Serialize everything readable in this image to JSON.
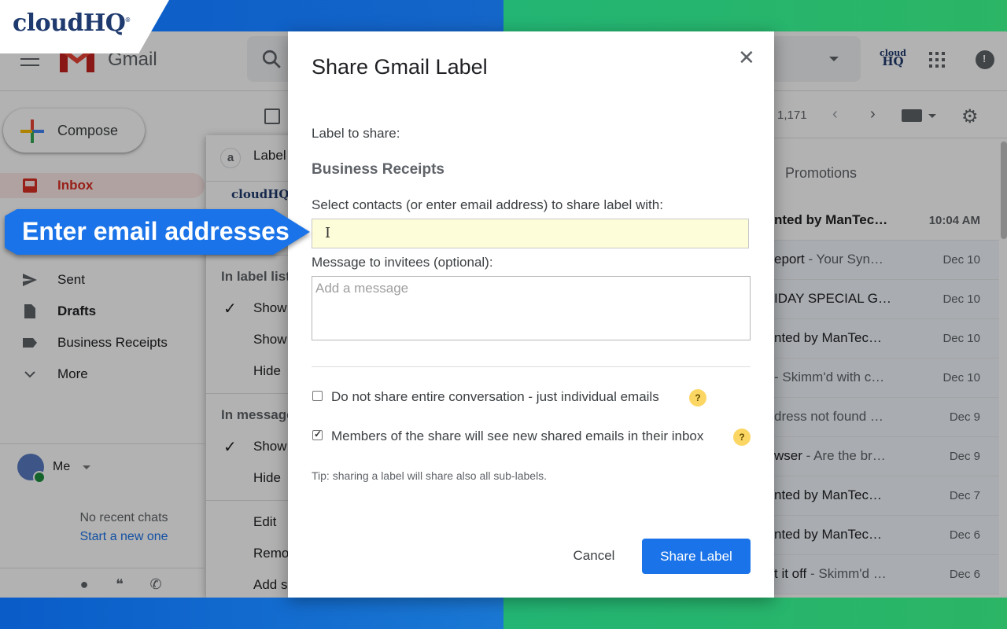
{
  "brand": {
    "name": "cloudHQ",
    "mark": "®"
  },
  "gmail": {
    "product": "Gmail",
    "compose_label": "Compose",
    "nav": [
      {
        "label": "Inbox",
        "icon": "inbox-icon"
      },
      {
        "label": "Sent",
        "icon": "send-icon"
      },
      {
        "label": "Drafts",
        "icon": "draft-icon"
      },
      {
        "label": "Business Receipts",
        "icon": "label-icon"
      },
      {
        "label": "More",
        "icon": "chevron-down-icon"
      }
    ],
    "me_label": "Me",
    "no_chats": "No recent chats",
    "start_new": "Start a new one",
    "page_count": "1,171",
    "promotions_tab": "Promotions",
    "header_hq": {
      "top": "cloud",
      "bottom": "HQ"
    },
    "emails": [
      {
        "subject": "nted by ManTec…",
        "snippet": "",
        "date": "10:04 AM",
        "unread": true
      },
      {
        "subject": "eport",
        "snippet": " - Your Syn…",
        "date": "Dec 10",
        "unread": false
      },
      {
        "subject": "IDAY SPECIAL G…",
        "snippet": "",
        "date": "Dec 10",
        "unread": false
      },
      {
        "subject": "nted by ManTec…",
        "snippet": "",
        "date": "Dec 10",
        "unread": false
      },
      {
        "subject": "",
        "snippet": "- Skimm'd with c…",
        "date": "Dec 10",
        "unread": false
      },
      {
        "subject": "",
        "snippet": "dress not found …",
        "date": "Dec 9",
        "unread": false
      },
      {
        "subject": "wser",
        "snippet": "  - Are the br…",
        "date": "Dec 9",
        "unread": false
      },
      {
        "subject": "nted by ManTec…",
        "snippet": "",
        "date": "Dec 7",
        "unread": false
      },
      {
        "subject": "nted by ManTec…",
        "snippet": "",
        "date": "Dec 6",
        "unread": false
      },
      {
        "subject": "t it off",
        "snippet": " - Skimm'd …",
        "date": "Dec 6",
        "unread": false
      }
    ]
  },
  "label_menu": {
    "letter": "a",
    "title": "Label",
    "hq_fragment": "cloudHQ",
    "section_label_list": "In label list",
    "section_message_list": "In message",
    "items": [
      "Show",
      "Show",
      "Hide",
      "Show",
      "Hide",
      "Edit",
      "Remo",
      "Add s"
    ]
  },
  "callout": {
    "text": "Enter email addresses"
  },
  "dialog": {
    "title": "Share Gmail Label",
    "close_glyph": "✕",
    "label_to_share": "Label to share:",
    "label_name": "Business Receipts",
    "select_contacts": "Select contacts (or enter email address) to share label with:",
    "contacts_value": "",
    "message_label": "Message to invitees (optional):",
    "message_placeholder": "Add a message",
    "opt_individual": "Do not share entire conversation - just individual emails",
    "opt_individual_checked": false,
    "opt_inbox": "Members of the share will see new shared emails in their inbox",
    "opt_inbox_checked": true,
    "help_glyph": "?",
    "tip": "Tip: sharing a label will share also all sub-labels.",
    "cancel": "Cancel",
    "share": "Share Label"
  },
  "colors": {
    "primary": "#1a73e8",
    "frame_blue": "#0a5cc8",
    "frame_green": "#23b574",
    "input_highlight": "#fefdd9",
    "help_badge": "#fcd663",
    "inbox_red": "#d93025"
  }
}
